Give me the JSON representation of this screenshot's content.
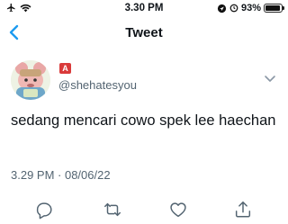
{
  "status_bar": {
    "time": "3.30 PM",
    "battery_percent_text": "93%",
    "battery_level": 0.93
  },
  "nav": {
    "title": "Tweet"
  },
  "author": {
    "badge_letter": "A",
    "handle": "@shehatesyou"
  },
  "tweet": {
    "text": "sedang mencari cowo spek lee haechan",
    "timestamp": "3.29 PM · 08/06/22"
  },
  "icons": {
    "back": "chevron-left-icon",
    "more": "chevron-down-icon",
    "reply": "reply-icon",
    "retweet": "retweet-icon",
    "like": "heart-icon",
    "share": "share-icon"
  },
  "colors": {
    "accent": "#1d9bf0",
    "text": "#0f1419",
    "muted": "#536471"
  }
}
